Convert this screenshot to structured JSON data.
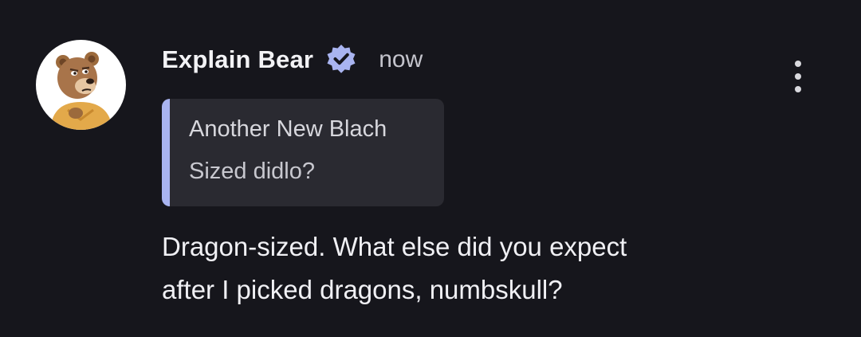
{
  "message": {
    "author": "Explain Bear",
    "verified_icon": "verified-badge-icon",
    "timestamp": "now",
    "menu_icon": "more-vertical-icon",
    "quote": {
      "author": "Another New Blach",
      "text": "Sized didlo?"
    },
    "body_lines": [
      "Dragon-sized. What else did you expect",
      "after I picked dragons, numbskull?"
    ]
  },
  "colors": {
    "background": "#16161c",
    "quote_background": "#2a2a31",
    "quote_accent": "#a9b4f0",
    "verified_badge": "#a9b4f0"
  }
}
